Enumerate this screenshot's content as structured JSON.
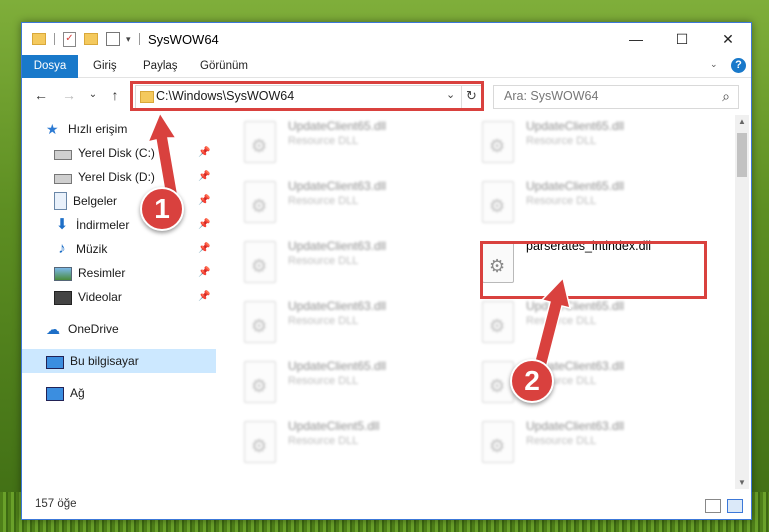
{
  "window": {
    "title": "SysWOW64"
  },
  "titlebar": {
    "minimize": "—",
    "maximize": "☐",
    "close": "✕"
  },
  "ribbon": {
    "tabs": [
      "Dosya",
      "Giriş",
      "Paylaş",
      "Görünüm"
    ],
    "help_icon": "?"
  },
  "nav": {
    "back": "←",
    "forward": "→",
    "recent": "⌄",
    "up": "↑"
  },
  "address": {
    "path": "C:\\Windows\\SysWOW64",
    "dropdown": "⌄",
    "refresh": "↻"
  },
  "search": {
    "placeholder": "Ara: SysWOW64",
    "icon": "⌕"
  },
  "sidebar": {
    "quick_access": "Hızlı erişim",
    "items": [
      {
        "label": "Yerel Disk (C:)",
        "icon": "drive-icon"
      },
      {
        "label": "Yerel Disk (D:)",
        "icon": "drive-icon"
      },
      {
        "label": "Belgeler",
        "icon": "documents-icon"
      },
      {
        "label": "İndirmeler",
        "icon": "downloads-icon"
      },
      {
        "label": "Müzik",
        "icon": "music-icon"
      },
      {
        "label": "Resimler",
        "icon": "pictures-icon"
      },
      {
        "label": "Videolar",
        "icon": "videos-icon"
      }
    ],
    "onedrive": "OneDrive",
    "this_pc": "Bu bilgisayar",
    "network": "Ağ"
  },
  "files": {
    "left": [
      {
        "name": "UpdateClient65.dll",
        "desc": "Resource DLL"
      },
      {
        "name": "UpdateClient63.dll",
        "desc": "Resource DLL"
      },
      {
        "name": "UpdateClient63.dll",
        "desc": "Resource DLL"
      },
      {
        "name": "UpdateClient63.dll",
        "desc": "Resource DLL"
      },
      {
        "name": "UpdateClient65.dll",
        "desc": "Resource DLL"
      },
      {
        "name": "UpdateClient5.dll",
        "desc": "Resource DLL"
      }
    ],
    "right": [
      {
        "name": "UpdateClient65.dll",
        "desc": "Resource DLL"
      },
      {
        "name": "UpdateClient65.dll",
        "desc": "Resource DLL"
      },
      {
        "name": "parserates_intindex.dll",
        "desc": ""
      },
      {
        "name": "UpdateClient65.dll",
        "desc": "Resource DLL"
      },
      {
        "name": "UpdateClient63.dll",
        "desc": "Resource DLL"
      },
      {
        "name": "UpdateClient63.dll",
        "desc": "Resource DLL"
      }
    ]
  },
  "status": {
    "count": "157 öğe"
  },
  "callouts": [
    "1",
    "2"
  ],
  "colors": {
    "accent": "#1979ca",
    "highlight": "#d9413e",
    "selected": "#cce8ff"
  }
}
